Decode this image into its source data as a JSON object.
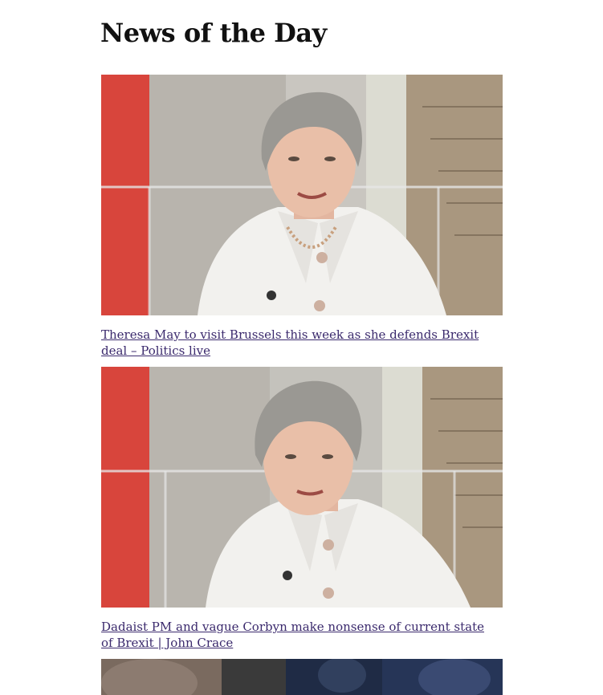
{
  "page": {
    "title": "News of the Day"
  },
  "stories": [
    {
      "headline": "Theresa May to visit Brussels this week as she defends Brexit deal – Politics live",
      "image_alt": "Theresa May in white jacket during TV interview"
    },
    {
      "headline": "Dadaist PM and vague Corbyn make nonsense of current state of Brexit | John Crace",
      "image_alt": "Theresa May speaking in TV studio"
    },
    {
      "headline": "",
      "image_alt": "Crowd photo (partially visible)"
    }
  ],
  "colors": {
    "link": "#3b2a6d",
    "studio_red": "#d8453c",
    "studio_wall": "#c9c6c0",
    "jacket": "#f2f1ee",
    "hair": "#9a9893"
  }
}
